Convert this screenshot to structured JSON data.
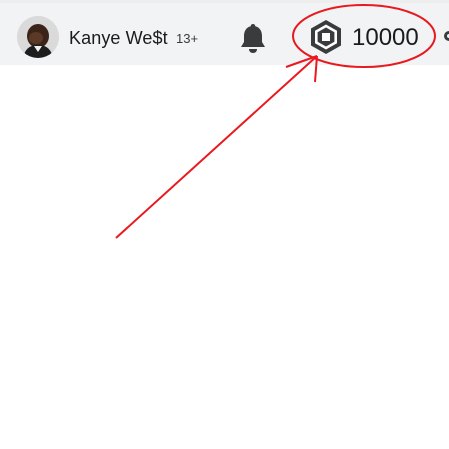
{
  "header": {
    "avatar_icon": "user-avatar",
    "username": "Kanye We$t",
    "age_badge": "13+",
    "notifications_icon": "bell-icon",
    "robux": {
      "icon": "robux-icon",
      "amount": "10000"
    },
    "settings_icon": "gear-icon"
  },
  "annotation": {
    "color": "#e8191f",
    "shapes": [
      "ellipse-around-robux-balance",
      "arrow-pointing-to-robux-icon"
    ]
  },
  "colors": {
    "topbar_background": "#f2f3f5",
    "text_primary": "#191b1d",
    "icon_dark": "#393b3d"
  }
}
